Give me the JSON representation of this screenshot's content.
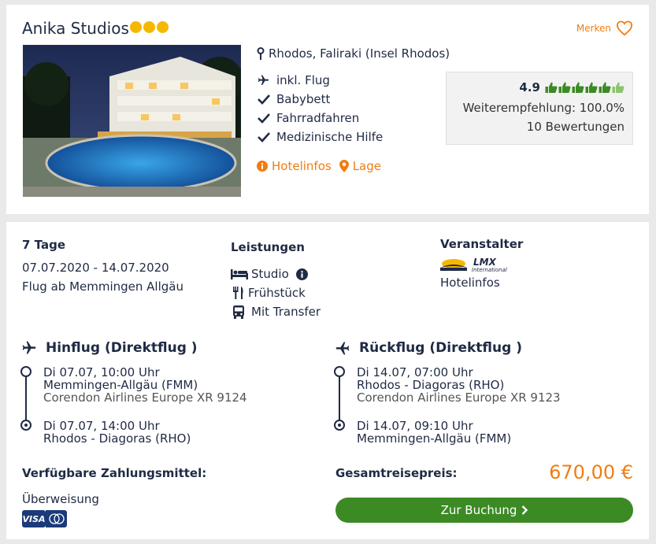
{
  "hotel": {
    "name": "Anika Studios",
    "stars": 3,
    "merken_label": "Merken",
    "location": "Rhodos, Faliraki (Insel Rhodos)",
    "features": [
      "inkl. Flug",
      "Babybett",
      "Fahrradfahren",
      "Medizinische Hilfe"
    ],
    "links": {
      "hotelinfos": "Hotelinfos",
      "lage": "Lage"
    },
    "rating": {
      "score": "4.9",
      "recommendation": "Weiterempfehlung: 100.0%",
      "reviews": "10 Bewertungen",
      "thumbs_filled": 5,
      "thumbs_total": 6
    }
  },
  "trip": {
    "duration": "7 Tage",
    "dates": "07.07.2020 - 14.07.2020",
    "departure": "Flug ab Memmingen Allgäu"
  },
  "services": {
    "heading": "Leistungen",
    "items": [
      "Studio",
      "Frühstück",
      "Mit Transfer"
    ]
  },
  "operator": {
    "heading": "Veranstalter",
    "logo_text": "LMX",
    "logo_sub": "International",
    "hotelinfos": "Hotelinfos"
  },
  "outbound": {
    "heading": "Hinflug (Direktflug )",
    "dep_time": "Di 07.07, 10:00 Uhr",
    "dep_airport": "Memmingen-Allgäu (FMM)",
    "airline": "Corendon Airlines Europe XR 9124",
    "arr_time": "Di 07.07, 14:00 Uhr",
    "arr_airport": "Rhodos - Diagoras (RHO)"
  },
  "return": {
    "heading": "Rückflug (Direktflug )",
    "dep_time": "Di 14.07, 07:00 Uhr",
    "dep_airport": "Rhodos - Diagoras (RHO)",
    "airline": "Corendon Airlines Europe XR 9123",
    "arr_time": "Di 14.07, 09:10 Uhr",
    "arr_airport": "Memmingen-Allgäu (FMM)"
  },
  "payment": {
    "heading": "Verfügbare Zahlungsmittel:",
    "method": "Überweisung",
    "visa": "VISA"
  },
  "total": {
    "heading": "Gesamtreisepreis:",
    "price": "670,00 €",
    "button": "Zur Buchung"
  },
  "colors": {
    "navy": "#1f2a44",
    "orange": "#f07d12",
    "green": "#3c8a24",
    "star": "#f5b800"
  }
}
